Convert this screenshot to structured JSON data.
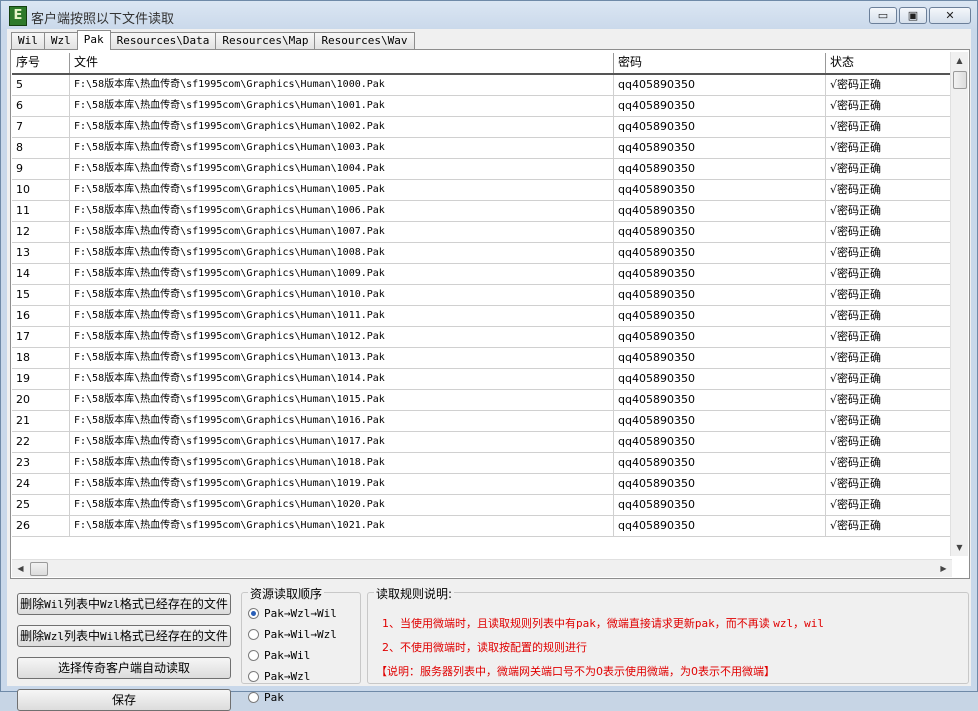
{
  "window": {
    "title": "客户端按照以下文件读取",
    "icon_letter": "E",
    "minimize": "▭",
    "restore": "▣",
    "close": "✕"
  },
  "tabs": [
    {
      "label": "Wil",
      "active": false
    },
    {
      "label": "Wzl",
      "active": false
    },
    {
      "label": "Pak",
      "active": true
    },
    {
      "label": "Resources\\Data",
      "active": false
    },
    {
      "label": "Resources\\Map",
      "active": false
    },
    {
      "label": "Resources\\Wav",
      "active": false
    }
  ],
  "grid": {
    "columns": [
      "序号",
      "文件",
      "密码",
      "状态"
    ],
    "rows": [
      [
        "5",
        "F:\\58版本库\\热血传奇\\sf1995com\\Graphics\\Human\\1000.Pak",
        "qq405890350",
        "√密码正确"
      ],
      [
        "6",
        "F:\\58版本库\\热血传奇\\sf1995com\\Graphics\\Human\\1001.Pak",
        "qq405890350",
        "√密码正确"
      ],
      [
        "7",
        "F:\\58版本库\\热血传奇\\sf1995com\\Graphics\\Human\\1002.Pak",
        "qq405890350",
        "√密码正确"
      ],
      [
        "8",
        "F:\\58版本库\\热血传奇\\sf1995com\\Graphics\\Human\\1003.Pak",
        "qq405890350",
        "√密码正确"
      ],
      [
        "9",
        "F:\\58版本库\\热血传奇\\sf1995com\\Graphics\\Human\\1004.Pak",
        "qq405890350",
        "√密码正确"
      ],
      [
        "10",
        "F:\\58版本库\\热血传奇\\sf1995com\\Graphics\\Human\\1005.Pak",
        "qq405890350",
        "√密码正确"
      ],
      [
        "11",
        "F:\\58版本库\\热血传奇\\sf1995com\\Graphics\\Human\\1006.Pak",
        "qq405890350",
        "√密码正确"
      ],
      [
        "12",
        "F:\\58版本库\\热血传奇\\sf1995com\\Graphics\\Human\\1007.Pak",
        "qq405890350",
        "√密码正确"
      ],
      [
        "13",
        "F:\\58版本库\\热血传奇\\sf1995com\\Graphics\\Human\\1008.Pak",
        "qq405890350",
        "√密码正确"
      ],
      [
        "14",
        "F:\\58版本库\\热血传奇\\sf1995com\\Graphics\\Human\\1009.Pak",
        "qq405890350",
        "√密码正确"
      ],
      [
        "15",
        "F:\\58版本库\\热血传奇\\sf1995com\\Graphics\\Human\\1010.Pak",
        "qq405890350",
        "√密码正确"
      ],
      [
        "16",
        "F:\\58版本库\\热血传奇\\sf1995com\\Graphics\\Human\\1011.Pak",
        "qq405890350",
        "√密码正确"
      ],
      [
        "17",
        "F:\\58版本库\\热血传奇\\sf1995com\\Graphics\\Human\\1012.Pak",
        "qq405890350",
        "√密码正确"
      ],
      [
        "18",
        "F:\\58版本库\\热血传奇\\sf1995com\\Graphics\\Human\\1013.Pak",
        "qq405890350",
        "√密码正确"
      ],
      [
        "19",
        "F:\\58版本库\\热血传奇\\sf1995com\\Graphics\\Human\\1014.Pak",
        "qq405890350",
        "√密码正确"
      ],
      [
        "20",
        "F:\\58版本库\\热血传奇\\sf1995com\\Graphics\\Human\\1015.Pak",
        "qq405890350",
        "√密码正确"
      ],
      [
        "21",
        "F:\\58版本库\\热血传奇\\sf1995com\\Graphics\\Human\\1016.Pak",
        "qq405890350",
        "√密码正确"
      ],
      [
        "22",
        "F:\\58版本库\\热血传奇\\sf1995com\\Graphics\\Human\\1017.Pak",
        "qq405890350",
        "√密码正确"
      ],
      [
        "23",
        "F:\\58版本库\\热血传奇\\sf1995com\\Graphics\\Human\\1018.Pak",
        "qq405890350",
        "√密码正确"
      ],
      [
        "24",
        "F:\\58版本库\\热血传奇\\sf1995com\\Graphics\\Human\\1019.Pak",
        "qq405890350",
        "√密码正确"
      ],
      [
        "25",
        "F:\\58版本库\\热血传奇\\sf1995com\\Graphics\\Human\\1020.Pak",
        "qq405890350",
        "√密码正确"
      ],
      [
        "26",
        "F:\\58版本库\\热血传奇\\sf1995com\\Graphics\\Human\\1021.Pak",
        "qq405890350",
        "√密码正确"
      ]
    ]
  },
  "scroll": {
    "up": "▲",
    "down": "▼",
    "left": "◀",
    "right": "▶"
  },
  "buttons": {
    "delete_wil_pre": "删除",
    "delete_wil_mono": "Wil",
    "delete_wil_mid": "列表中",
    "delete_wil_mono2": "Wzl",
    "delete_wil_post": "格式已经存在的文件",
    "delete_wzl_pre": "删除",
    "delete_wzl_mono": "Wzl",
    "delete_wzl_mid": "列表中",
    "delete_wzl_mono2": "Wil",
    "delete_wzl_post": "格式已经存在的文件",
    "auto_read": "选择传奇客户端自动读取",
    "save": "保存"
  },
  "order_group": {
    "title": "资源读取顺序",
    "options": [
      {
        "label": "Pak→Wzl→Wil",
        "selected": true
      },
      {
        "label": "Pak→Wil→Wzl",
        "selected": false
      },
      {
        "label": "Pak→Wil",
        "selected": false
      },
      {
        "label": "Pak→Wzl",
        "selected": false
      },
      {
        "label": "Pak",
        "selected": false
      }
    ]
  },
  "rules_group": {
    "title": "读取规则说明:",
    "rule1_pre": "1、当使用微端时，且读取规则列表中有",
    "rule1_mono": "pak",
    "rule1_mid": "，微端直接请求更新",
    "rule1_mono2": "pak",
    "rule1_post": "，而不再读 ",
    "rule1_mono3": "wzl，wil",
    "rule2": "2、不使用微端时，读取按配置的规则进行",
    "rule3": "【说明：服务器列表中，微端网关端口号不为0表示使用微端，为0表示不用微端】"
  },
  "colors": {
    "rule_text": "#e00000",
    "radio_dot": "#2a5fb8"
  }
}
